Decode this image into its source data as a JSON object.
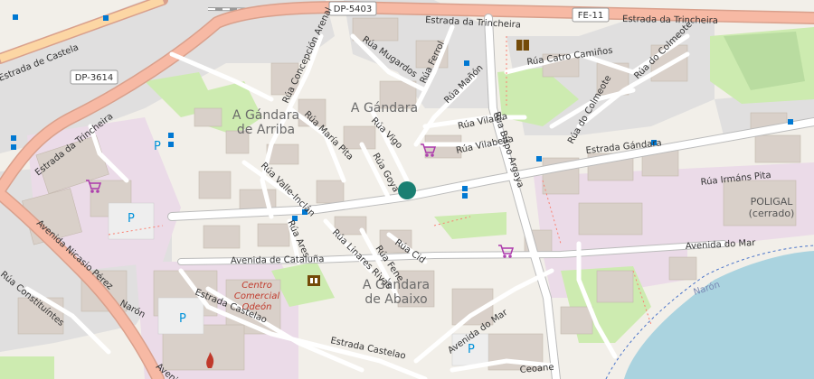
{
  "map": {
    "colors": {
      "background": "#f2efe9",
      "residential": "#e0dfdf",
      "park": "#cdebb0",
      "water": "#aad3df",
      "major_road": "#f7b9a4",
      "road_casing": "#d9a08c",
      "minor_road": "#ffffff",
      "building": "#d9d0c9",
      "marker": "#1a7f72",
      "bus_stop": "#0078d2"
    },
    "districts": {
      "gandara": "A Gándara",
      "gandara_arriba_1": "A Gándara",
      "gandara_arriba_2": "de Arriba",
      "gandara_abaixo_1": "A Gándara",
      "gandara_abaixo_2": "de Abaixo"
    },
    "shields": {
      "dp5403": "DP-5403",
      "dp3614": "DP-3614",
      "fe11": "FE-11"
    },
    "streets": {
      "estrada_trincheira_top": "Estrada da Trincheira",
      "estrada_trincheira_top2": "Estrada da Trincheira",
      "estrada_trincheira_left": "Estrada da Trincheira",
      "estrada_castela": "Estrada de Castela",
      "avenida_nicasio": "Avenida Nicasio Pérez",
      "constituintes": "Rúa Constituíntes",
      "rua_mugardos": "Rúa Mugardos",
      "rua_concepcion": "Rúa Concepción Arenal",
      "rua_ferrol": "Rúa Ferrol",
      "rua_manon": "Rúa Mañón",
      "rua_catro_caminos": "Rúa Catro Camiños",
      "rua_colmeote": "Rúa do Colmeote",
      "rua_colmeote2": "Rúa do Colmeote",
      "rua_maria_pita": "Rúa María Pita",
      "rua_vigo": "Rúa Vigo",
      "rua_vilalba": "Rúa Vilalba",
      "rua_vilabella": "Rúa Vilabella",
      "rua_bispo": "Rúa Bispo Argaya",
      "estrada_gandara": "Estrada Gándara",
      "rua_irmans_pita": "Rúa Irmáns Pita",
      "rua_valle_inclan": "Rúa Valle-Inclán",
      "rua_goya": "Rúa Goya",
      "rua_ares": "Rúa Ares",
      "rua_linares": "Rúa Linares Rivas",
      "rua_fene": "Rúa Fene",
      "rua_cid": "Rúa Cid",
      "avenida_cataluna": "Avenida de Cataluña",
      "avenida_mar": "Avenida do Mar",
      "avenida_mar2": "Avenida do Mar",
      "estrada_castelao": "Estrada Castelao",
      "estrada_castelao2": "Estrada Castelao",
      "naron": "Narón",
      "naron_water": "Narón",
      "ceoane": "Ceoane",
      "avenida_bottom": "Avenida"
    },
    "pois": {
      "poligal_1": "POLIGAL",
      "poligal_2": "(cerrado)",
      "centro_1": "Centro",
      "centro_2": "Comercial",
      "centro_3": "Odeón"
    }
  }
}
